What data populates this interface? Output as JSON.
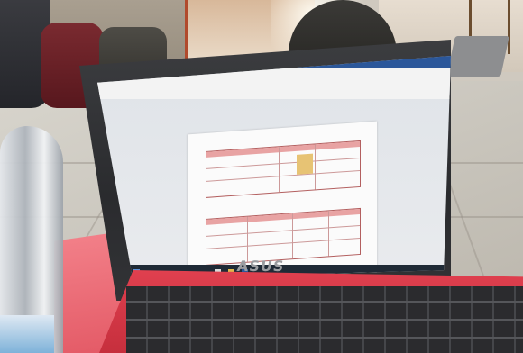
{
  "scene": {
    "description_free": true
  },
  "laptop": {
    "brand": "ASUS",
    "colors": {
      "deck": "#d63a48",
      "bezel": "#2f3033"
    },
    "screen": {
      "app": "word-processor",
      "document_title": "",
      "taskbar_visible": true
    }
  }
}
